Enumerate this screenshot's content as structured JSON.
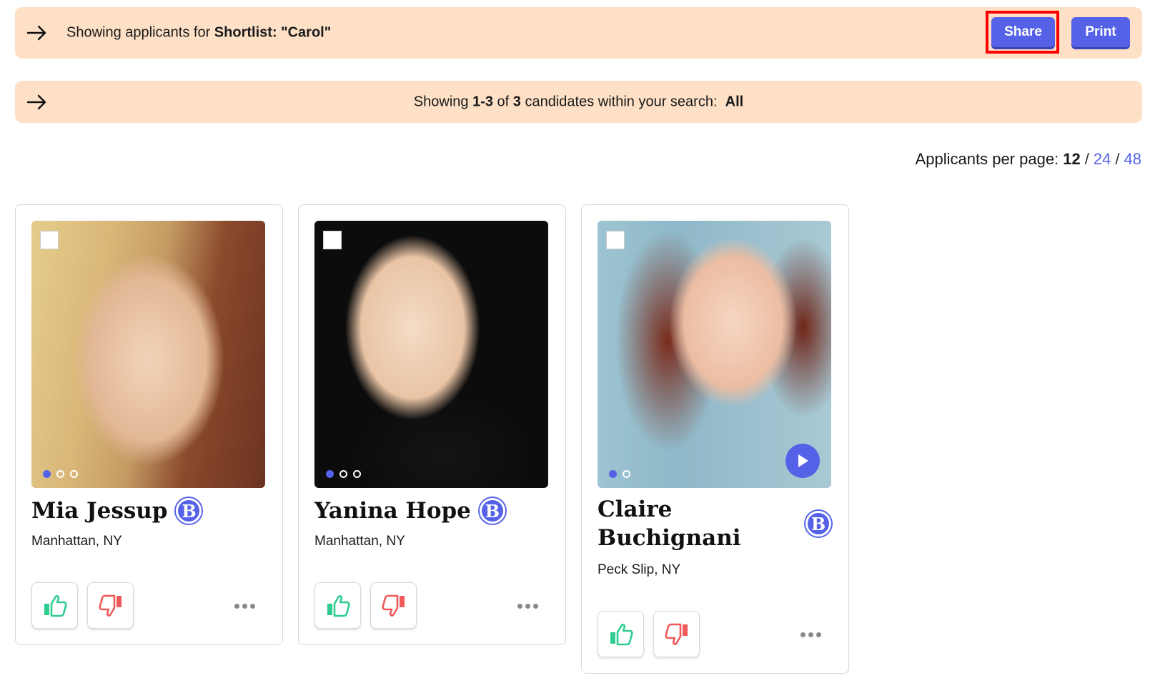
{
  "banner_shortlist": {
    "prefix": "Showing applicants for ",
    "shortlist_label": "Shortlist: \"Carol\"",
    "share_label": "Share",
    "print_label": "Print"
  },
  "banner_search": {
    "text_1": "Showing ",
    "range": "1-3",
    "text_2": " of ",
    "total": "3",
    "text_3": " candidates within your search: ",
    "filter": "All"
  },
  "pagination": {
    "label": "Applicants per page: ",
    "current": "12",
    "options": [
      "24",
      "48"
    ],
    "separator": "/"
  },
  "candidates": [
    {
      "name": "Mia Jessup",
      "location": "Manhattan, NY",
      "badge": "B",
      "photo_count": 3,
      "has_video": false,
      "photo_bg": [
        "#8a4a2c",
        "#c9a27a",
        "#e8c98f"
      ]
    },
    {
      "name": "Yanina Hope",
      "location": "Manhattan, NY",
      "badge": "B",
      "photo_count": 3,
      "has_video": false,
      "photo_bg": [
        "#0d0d0d",
        "#1a1a1a",
        "#e9c9a8"
      ]
    },
    {
      "name": "Claire Buchignani",
      "location": "Peck Slip, NY",
      "badge": "B",
      "photo_count": 2,
      "has_video": true,
      "photo_bg": [
        "#8fb8c8",
        "#7a2c1c",
        "#f0c9b0"
      ]
    }
  ],
  "colors": {
    "accent": "#5562e8",
    "banner": "#fde0c6",
    "thumbs_up": "#2ecc8f",
    "thumbs_down": "#f05a5a"
  }
}
